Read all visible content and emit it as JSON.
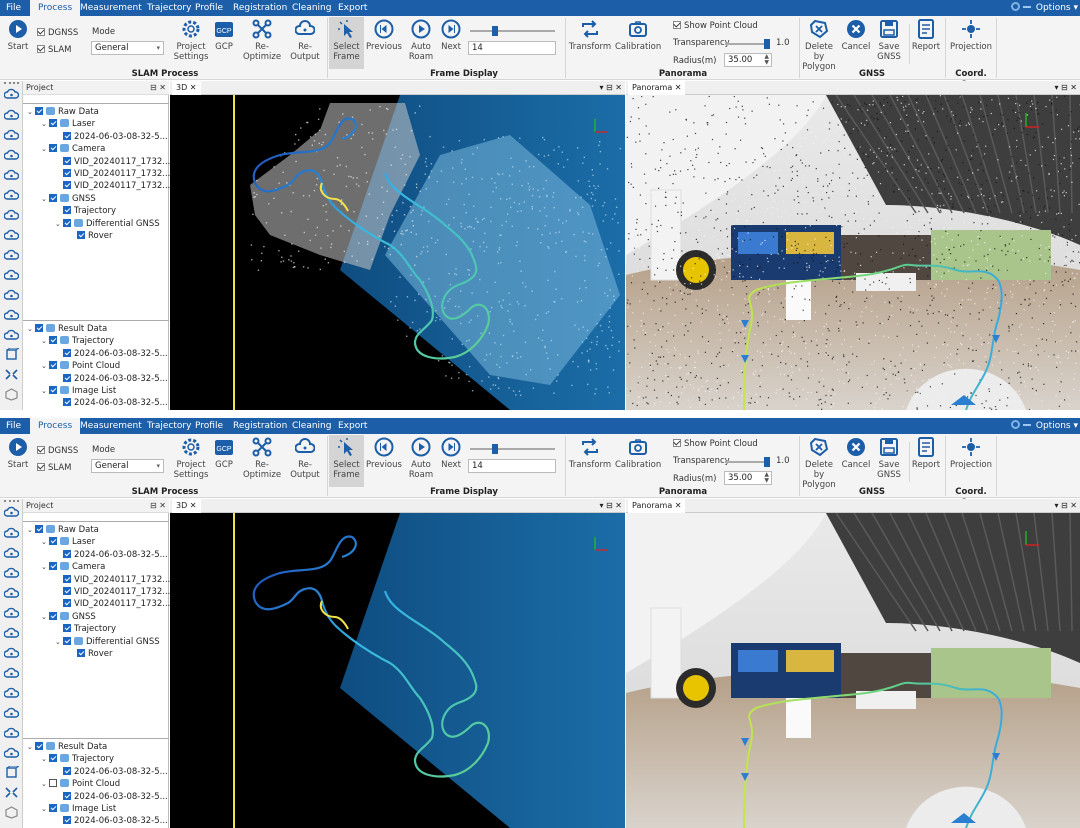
{
  "menu": {
    "items": [
      "File",
      "Process",
      "Measurement",
      "Trajectory",
      "Profile",
      "Registration",
      "Cleaning",
      "Export"
    ],
    "active": "Process",
    "options_label": "Options"
  },
  "ribbon": {
    "start_label": "Start",
    "dgnss_label": "DGNSS",
    "slam_label": "SLAM",
    "mode_label": "Mode",
    "mode_value": "General",
    "project_settings_label": "Project\nSettings",
    "gcp_label": "GCP",
    "reoptimize_label": "Re-\nOptimize",
    "reoutput_label": "Re-\nOutput",
    "slam_group": "SLAM Process",
    "select_frame_label": "Select\nFrame",
    "previous_label": "Previous",
    "auto_roam_label": "Auto\nRoam",
    "next_label": "Next",
    "frame_value": "14",
    "frame_group": "Frame Display",
    "transform_label": "Transform",
    "calibration_label": "Calibration",
    "show_point_cloud_label": "Show Point Cloud",
    "transparency_label": "Transparency",
    "transparency_value": "1.0",
    "radius_label": "Radius(m)",
    "radius_value": "35.00",
    "panorama_group": "Panorama",
    "delete_polygon_label": "Delete by\nPolygon",
    "cancel_label": "Cancel",
    "save_gnss_label": "Save\nGNSS",
    "report_label": "Report",
    "gnss_group": "GNSS",
    "projection_label": "Projection",
    "coord_group": "Coord. Sys."
  },
  "project_panel": {
    "title": "Project",
    "controls": "⊟ ✕",
    "raw_tree": [
      {
        "label": "Raw Data",
        "level": 0,
        "expander": true
      },
      {
        "label": "Laser",
        "level": 1,
        "expander": true
      },
      {
        "label": "2024-06-03-08-32-5...",
        "level": 2,
        "expander": false
      },
      {
        "label": "Camera",
        "level": 1,
        "expander": true
      },
      {
        "label": "VID_20240117_1732...",
        "level": 2,
        "expander": false
      },
      {
        "label": "VID_20240117_1732...",
        "level": 2,
        "expander": false
      },
      {
        "label": "VID_20240117_1732...",
        "level": 2,
        "expander": false
      },
      {
        "label": "GNSS",
        "level": 1,
        "expander": true
      },
      {
        "label": "Trajectory",
        "level": 2,
        "expander": false
      },
      {
        "label": "Differential GNSS",
        "level": 2,
        "expander": true
      },
      {
        "label": "Rover",
        "level": 3,
        "expander": false
      }
    ],
    "result_tree": [
      {
        "label": "Result Data",
        "level": 0,
        "expander": true
      },
      {
        "label": "Trajectory",
        "level": 1,
        "expander": true
      },
      {
        "label": "2024-06-03-08-32-5...",
        "level": 2,
        "expander": false
      },
      {
        "label": "Point Cloud",
        "level": 1,
        "expander": true
      },
      {
        "label": "2024-06-03-08-32-5...",
        "level": 2,
        "expander": false
      },
      {
        "label": "Image List",
        "level": 1,
        "expander": true
      },
      {
        "label": "2024-06-03-08-32-5...",
        "level": 2,
        "expander": false
      }
    ]
  },
  "views": {
    "view3d_tab": "3D",
    "panorama_tab": "Panorama",
    "tab_close": "✕",
    "tab_controls": "▾ ⊟ ✕"
  },
  "screens": [
    {
      "id": "top",
      "point_cloud_checked": true
    },
    {
      "id": "bottom",
      "point_cloud_checked": false
    }
  ],
  "colors": {
    "menu_bar": "#1d5ea8",
    "ribbon_bg": "#f4f4f4",
    "checkbox_blue": "#1a66c2",
    "trajectory_start": "#1a3fb5",
    "trajectory_mid": "#35b7e6",
    "trajectory_end": "#5fd08c",
    "trajectory_yellow": "#f2e24a",
    "point_cloud_blue": "#2f8fd0"
  }
}
